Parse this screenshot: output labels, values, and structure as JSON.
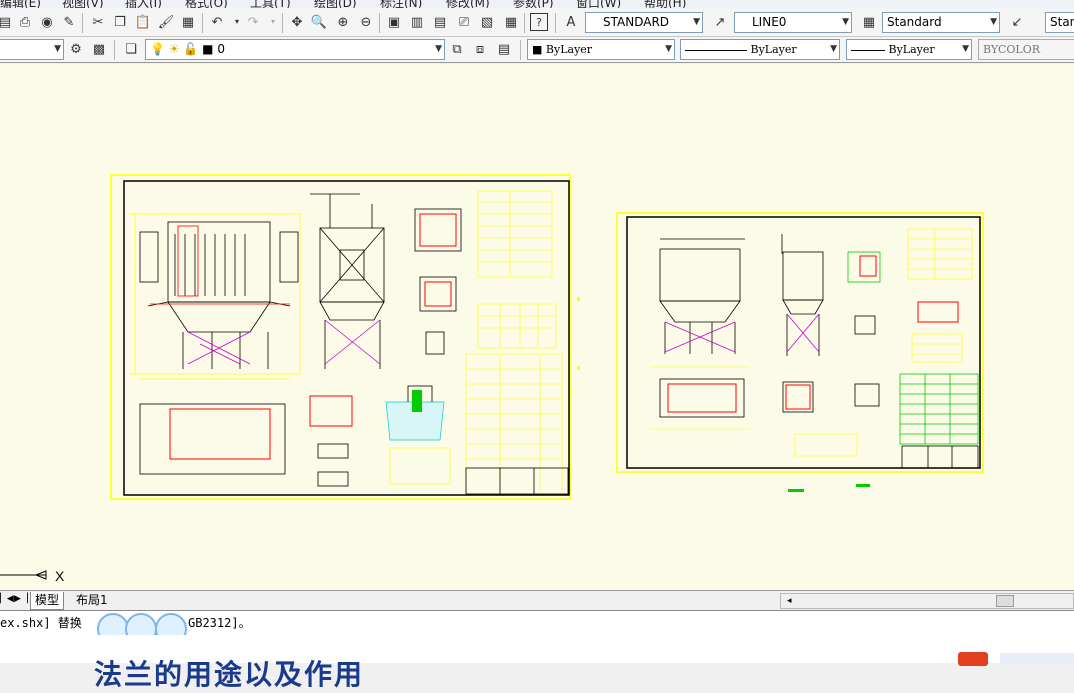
{
  "menu": {
    "items": [
      "编辑(E)",
      "视图(V)",
      "插入(I)",
      "格式(O)",
      "工具(T)",
      "绘图(D)",
      "标注(N)",
      "修改(M)",
      "参数(P)",
      "窗口(W)",
      "帮助(H)"
    ]
  },
  "toolbar": {
    "text_style": "STANDARD",
    "dim_style": "LINE0",
    "table_style": "Standard",
    "multileader_style": "Stan",
    "layer_value": "0",
    "color_value": "ByLayer",
    "linetype_value": "ByLayer",
    "lineweight_value": "ByLayer",
    "plotstyle_value": "BYCOLOR"
  },
  "tabs": {
    "model": "模型",
    "layout1": "布局1"
  },
  "ucs": {
    "x_label": "X"
  },
  "command": {
    "line_prefix": "ex.shx] 替换",
    "line_suffix": "GB2312]。"
  },
  "bottom": {
    "title": "法兰的用途以及作用"
  },
  "colors": {
    "canvas_bg": "#fcfbe8",
    "sheet_border": "#ffff00",
    "drawing_line": "#000000",
    "red": "#ff0000",
    "magenta": "#cc00cc",
    "green": "#00cc00",
    "cyan": "#00cccc",
    "bottom_title": "#1a3a8c"
  }
}
